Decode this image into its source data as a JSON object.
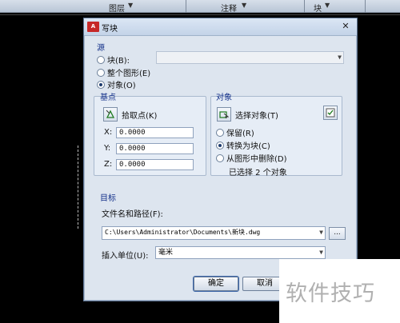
{
  "ribbon": {
    "items": [
      "图层",
      "注释",
      "块"
    ]
  },
  "dialog": {
    "title": "写块",
    "app_icon_text": "A",
    "close_glyph": "✕",
    "source": {
      "label": "源",
      "options": [
        "块(B):",
        "整个图形(E)",
        "对象(O)"
      ],
      "selected_index": 2,
      "block_combo_value": ""
    },
    "base_point": {
      "label": "基点",
      "pick_label": "拾取点(K)",
      "x_label": "X:",
      "y_label": "Y:",
      "z_label": "Z:",
      "x_value": "0.0000",
      "y_value": "0.0000",
      "z_value": "0.0000"
    },
    "objects": {
      "label": "对象",
      "select_label": "选择对象(T)",
      "options": [
        "保留(R)",
        "转换为块(C)",
        "从图形中删除(D)"
      ],
      "selected_index": 1,
      "status": "已选择 2 个对象"
    },
    "destination": {
      "label": "目标",
      "path_label": "文件名和路径(F):",
      "path_value": "C:\\Users\\Administrator\\Documents\\新块.dwg",
      "browse_label": "...",
      "unit_label": "插入单位(U):",
      "unit_value": "毫米"
    },
    "buttons": {
      "ok": "确定",
      "cancel": "取消"
    }
  },
  "watermark": "软件技巧"
}
